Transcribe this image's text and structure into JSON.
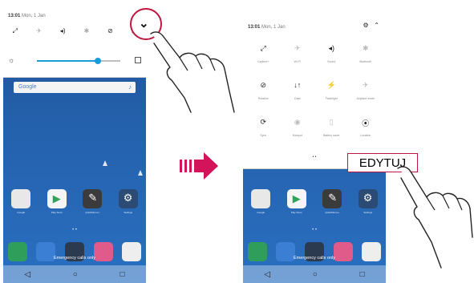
{
  "left_phone": {
    "status_time": "13:01",
    "status_date": "Mon, 1 Jan",
    "quick_icons": [
      "⤢",
      "✈",
      "◂)",
      "✱",
      "⊘",
      "↓↑"
    ],
    "quick_icon_names": [
      "screen-rotate-icon",
      "wifi-off-icon",
      "sound-icon",
      "bluetooth-off-icon",
      "dnd-icon",
      "data-icon"
    ],
    "brightness_level": 0.73,
    "search_logo": "Google",
    "home_apps": [
      "Google",
      "Play Store",
      "QuickMemo+",
      "Settings"
    ],
    "dock_label": "Emergency calls only"
  },
  "right_phone": {
    "status_time": "13:01",
    "status_date": "Mon, 1 Jan",
    "tiles": [
      {
        "icon": "⤢",
        "label": "Capture+",
        "active": true
      },
      {
        "icon": "✈",
        "label": "Wi-Fi",
        "active": false
      },
      {
        "icon": "◂)",
        "label": "Sound",
        "active": true
      },
      {
        "icon": "✱",
        "label": "Bluetooth",
        "active": false
      },
      {
        "icon": "⊘",
        "label": "Rotation",
        "active": true
      },
      {
        "icon": "↓↑",
        "label": "Data",
        "active": true
      },
      {
        "icon": "⚡",
        "label": "Flashlight",
        "active": false
      },
      {
        "icon": "✈",
        "label": "Airplane mode",
        "active": false
      },
      {
        "icon": "⟳",
        "label": "Sync",
        "active": true
      },
      {
        "icon": "◉",
        "label": "Hotspot",
        "active": false
      },
      {
        "icon": "▯",
        "label": "Battery saver",
        "active": false
      },
      {
        "icon": "⦿",
        "label": "Location",
        "active": true
      }
    ],
    "page_dots": "• •",
    "home_apps": [
      "Google",
      "Play Store",
      "QuickMemo+",
      "Settings"
    ],
    "dock_label": "Emergency calls only"
  },
  "callout": {
    "edit_label": "EDYTUJ",
    "expand_glyph": "⌄"
  },
  "colors": {
    "accent": "#c0163f",
    "slider": "#1a9bdc",
    "arrow": "#d4145a"
  }
}
